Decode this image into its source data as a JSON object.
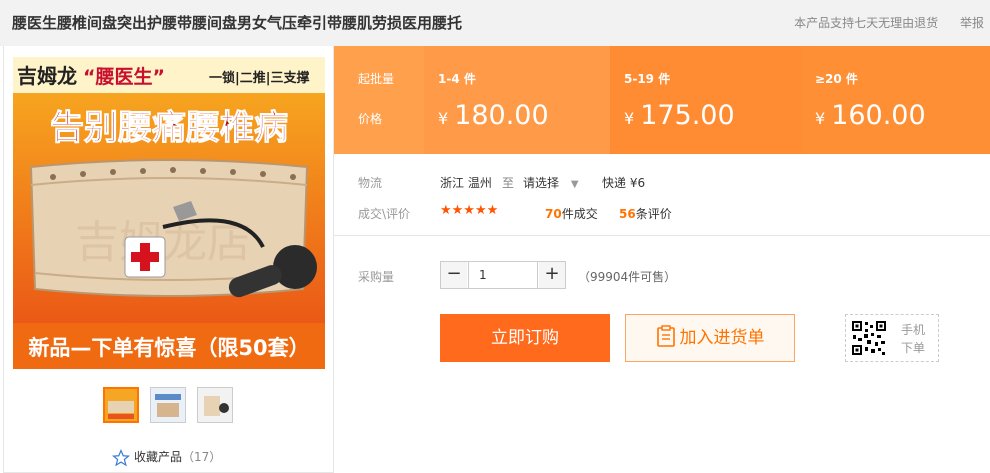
{
  "header": {
    "title": "腰医生腰椎间盘突出护腰带腰间盘男女气压牵引带腰肌劳损医用腰托",
    "return_policy": "本产品支持七天无理由退货",
    "report": "举报"
  },
  "product_image": {
    "brand": "吉姆龙",
    "slogan_quoted": "“腰医生”",
    "features": "一锁|二推|三支撑",
    "headline": "告别腰痛腰椎病",
    "watermark": "吉姆龙店",
    "promo": "新品—下单有惊喜（限50套）"
  },
  "thumbnails": [
    "thumb-1",
    "thumb-2",
    "thumb-3"
  ],
  "favorite": {
    "label": "收藏产品",
    "count": "（17）"
  },
  "pricing": {
    "moq_label": "起批量",
    "price_label": "价格",
    "currency": "¥",
    "tiers": [
      {
        "range": "1-4 件",
        "price": "180.00"
      },
      {
        "range": "5-19 件",
        "price": "175.00"
      },
      {
        "range": "≥20 件",
        "price": "160.00"
      }
    ],
    "colors": {
      "head": "#ffa04d",
      "tier1": "#ff9a48",
      "tier2": "#ff8c33",
      "tier3": "#ff8f35"
    }
  },
  "logistics": {
    "label": "物流",
    "origin": "浙江 温州",
    "to": "至",
    "destination": "请选择",
    "shipping": "快递 ¥6"
  },
  "reviews": {
    "label": "成交\\评价",
    "stars": "★★★★★",
    "sold_count": "70",
    "sold_suffix": "件成交",
    "review_count": "56",
    "review_suffix": "条评价"
  },
  "purchase": {
    "qty_label": "采购量",
    "minus": "−",
    "plus": "+",
    "quantity": "1",
    "stock": "（99904件可售）",
    "buy_label": "立即订购",
    "cart_label": "加入进货单",
    "mobile_label": "手机下单"
  }
}
